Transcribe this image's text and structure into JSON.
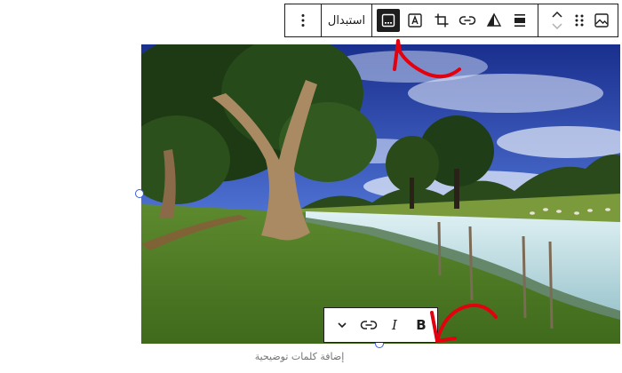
{
  "toolbar": {
    "replace_label": "استبدال",
    "items": [
      {
        "icon": "more-options-icon"
      },
      {
        "icon": "caption-icon",
        "active": true
      },
      {
        "icon": "text-overlay-icon"
      },
      {
        "icon": "crop-icon"
      },
      {
        "icon": "link-icon"
      },
      {
        "icon": "duotone-filter-icon"
      },
      {
        "icon": "align-icon"
      },
      {
        "icon": "move-up-down-icon"
      },
      {
        "icon": "drag-handle-icon"
      },
      {
        "icon": "image-block-icon"
      }
    ]
  },
  "format_toolbar": {
    "bold_label": "B",
    "italic_label": "I",
    "items": [
      {
        "icon": "chevron-down-icon"
      },
      {
        "icon": "link-icon"
      }
    ]
  },
  "caption": {
    "placeholder": "إضافة كلمات توضيحية"
  },
  "colors": {
    "accent": "#3858e9",
    "annotation": "#e3000f",
    "toolbar_border": "#1e1e1e"
  }
}
